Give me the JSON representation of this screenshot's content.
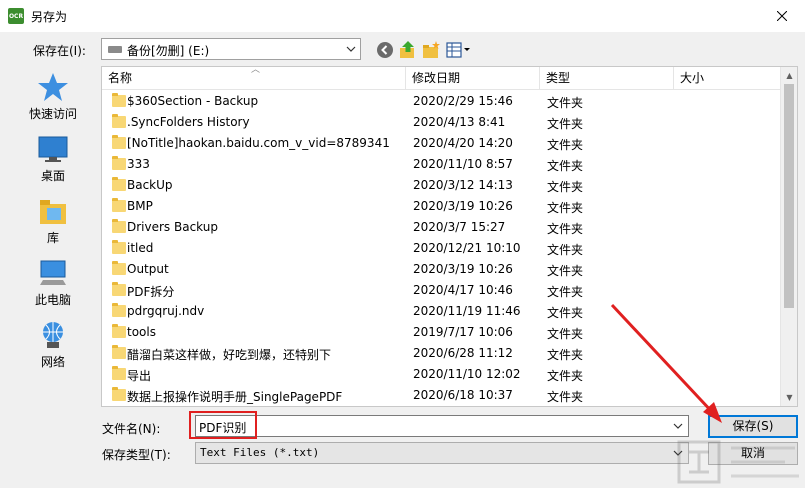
{
  "window": {
    "title": "另存为",
    "app_icon_text": "OCR"
  },
  "toolbar": {
    "save_in_label": "保存在(I):",
    "location": "备份[勿删] (E:)"
  },
  "places": [
    {
      "label": "快速访问",
      "icon": "quick-access-star-icon"
    },
    {
      "label": "桌面",
      "icon": "desktop-icon"
    },
    {
      "label": "库",
      "icon": "library-icon"
    },
    {
      "label": "此电脑",
      "icon": "this-pc-icon"
    },
    {
      "label": "网络",
      "icon": "network-icon"
    }
  ],
  "columns": {
    "name": "名称",
    "date": "修改日期",
    "type": "类型",
    "size": "大小"
  },
  "files": [
    {
      "name": "$360Section - Backup",
      "date": "2020/2/29 15:46",
      "type": "文件夹"
    },
    {
      "name": ".SyncFolders History",
      "date": "2020/4/13 8:41",
      "type": "文件夹"
    },
    {
      "name": "[NoTitle]haokan.baidu.com_v_vid=8789341",
      "date": "2020/4/20 14:20",
      "type": "文件夹"
    },
    {
      "name": "333",
      "date": "2020/11/10 8:57",
      "type": "文件夹"
    },
    {
      "name": "BackUp",
      "date": "2020/3/12 14:13",
      "type": "文件夹"
    },
    {
      "name": "BMP",
      "date": "2020/3/19 10:26",
      "type": "文件夹"
    },
    {
      "name": "Drivers Backup",
      "date": "2020/3/7 15:27",
      "type": "文件夹"
    },
    {
      "name": "itled",
      "date": "2020/12/21 10:10",
      "type": "文件夹"
    },
    {
      "name": "Output",
      "date": "2020/3/19 10:26",
      "type": "文件夹"
    },
    {
      "name": "PDF拆分",
      "date": "2020/4/17 10:46",
      "type": "文件夹"
    },
    {
      "name": "pdrgqruj.ndv",
      "date": "2020/11/19 11:46",
      "type": "文件夹"
    },
    {
      "name": "tools",
      "date": "2019/7/17 10:06",
      "type": "文件夹"
    },
    {
      "name": "醋溜白菜这样做，好吃到爆，还特别下",
      "date": "2020/6/28 11:12",
      "type": "文件夹"
    },
    {
      "name": "导出",
      "date": "2020/11/10 12:02",
      "type": "文件夹"
    },
    {
      "name": "数据上报操作说明手册_SinglePagePDF",
      "date": "2020/6/18 10:37",
      "type": "文件夹"
    }
  ],
  "filename": {
    "label": "文件名(N):",
    "value": "PDF识别"
  },
  "filetype": {
    "label": "保存类型(T):",
    "value": "Text Files (*.txt)"
  },
  "buttons": {
    "save": "保存(S)",
    "cancel": "取消"
  },
  "colors": {
    "accent": "#0078d7",
    "annotation": "#e02020",
    "folder": "#f8d775"
  }
}
